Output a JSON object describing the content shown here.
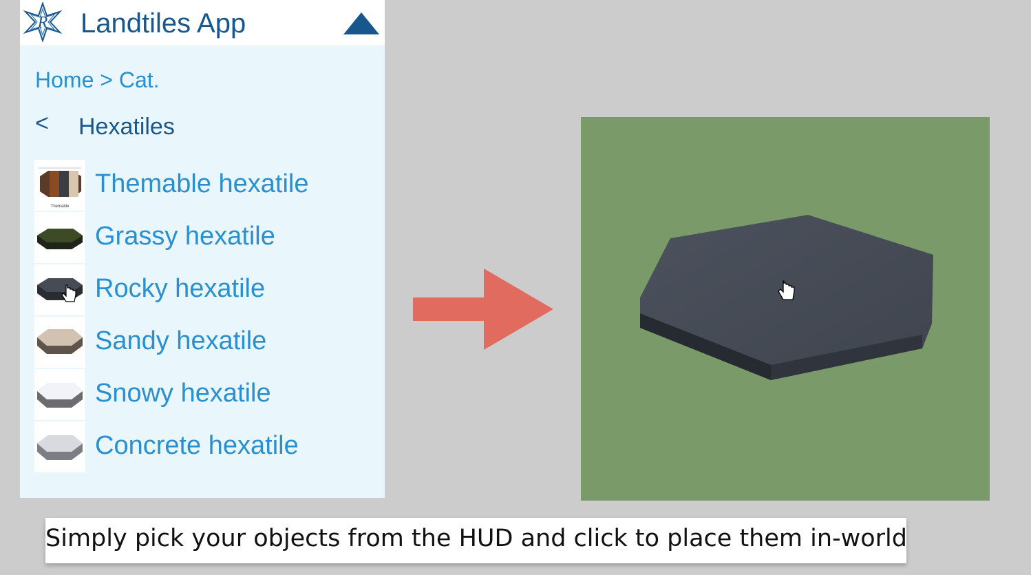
{
  "hud": {
    "title": "Landtiles App",
    "breadcrumb": {
      "home": "Home",
      "separator": ">",
      "current": "Cat."
    },
    "back_label": "<",
    "category_title": "Hexatiles",
    "thumb_caption": "Themable",
    "items": [
      {
        "label": "Themable hexatile",
        "icon": "themable-hexatile-thumbnail"
      },
      {
        "label": "Grassy hexatile",
        "icon": "grassy-hexatile-thumbnail"
      },
      {
        "label": "Rocky hexatile",
        "icon": "rocky-hexatile-thumbnail"
      },
      {
        "label": "Sandy hexatile",
        "icon": "sandy-hexatile-thumbnail"
      },
      {
        "label": "Snowy hexatile",
        "icon": "snowy-hexatile-thumbnail"
      },
      {
        "label": "Concrete hexatile",
        "icon": "concrete-hexatile-thumbnail"
      }
    ]
  },
  "caption": "Simply pick your objects from the HUD and click to place them in-world",
  "colors": {
    "accent": "#2a8fcf",
    "title": "#17578e",
    "hud_bg": "#e9f7fd",
    "arrow": "#e06b5e",
    "ground": "#7a9a6a",
    "page_bg": "#cccccc"
  }
}
